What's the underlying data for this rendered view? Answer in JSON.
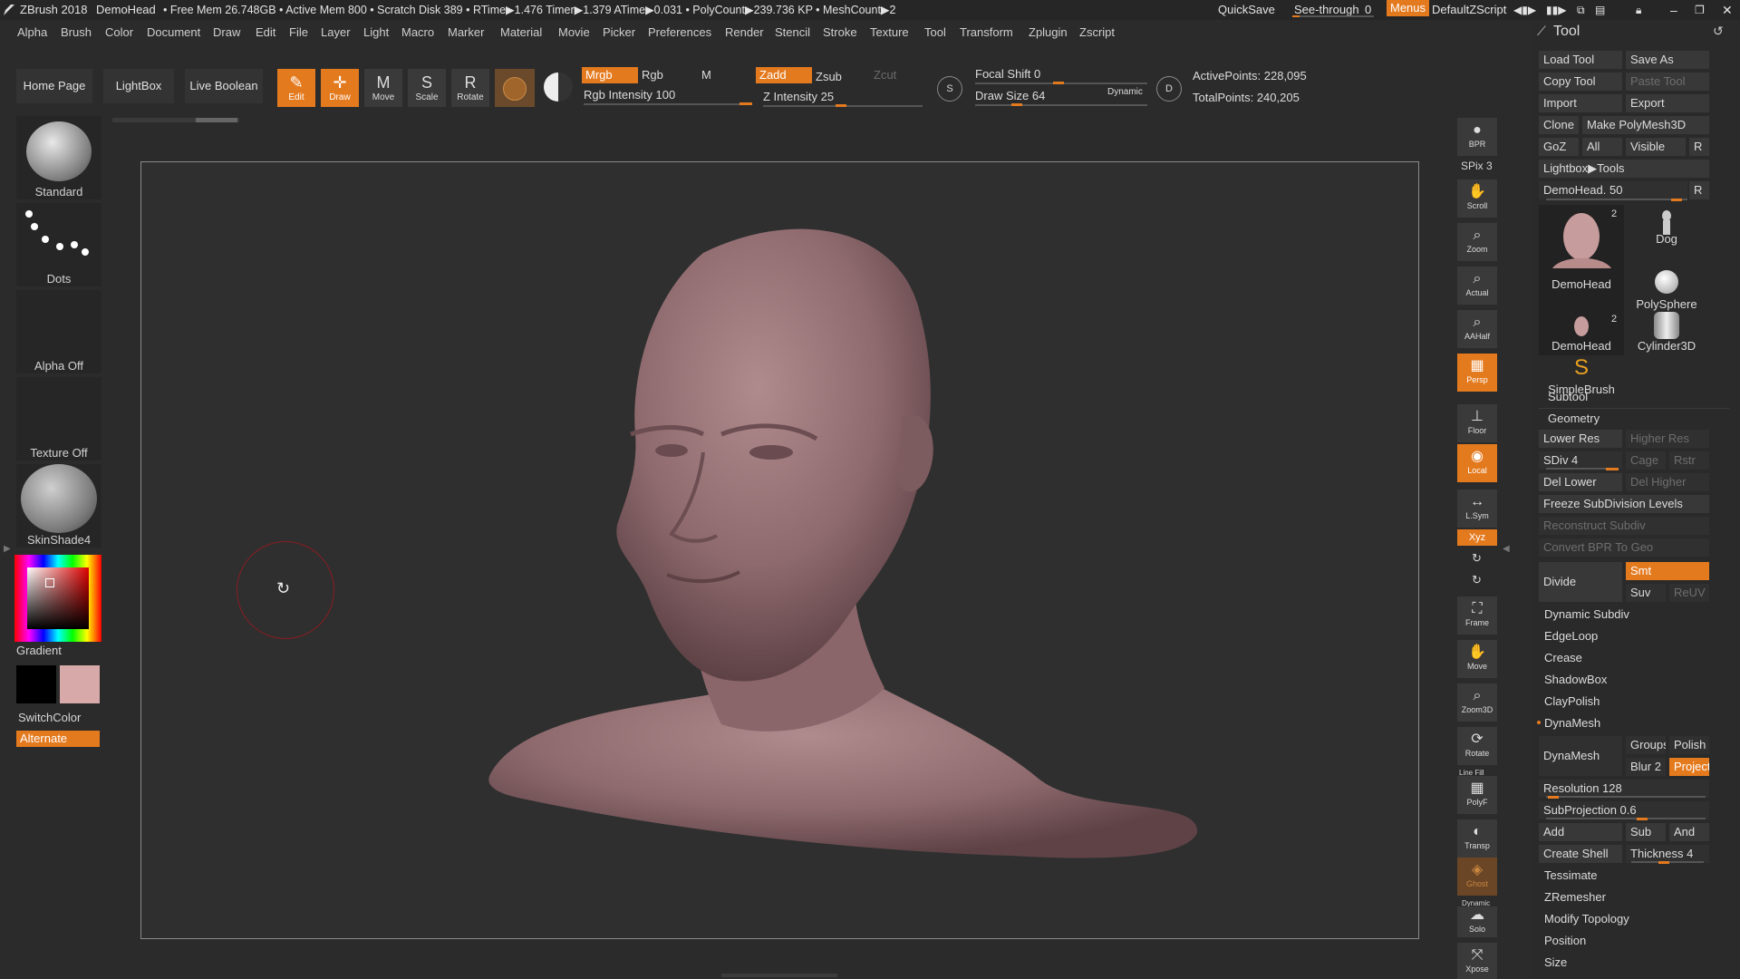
{
  "titlebar": {
    "app": "ZBrush 2018",
    "doc": "DemoHead",
    "stats": "• Free Mem 26.748GB • Active Mem 800 • Scratch Disk 389 •  RTime▶1.476 Timer▶1.379 ATime▶0.031 • PolyCount▶239.736 KP • MeshCount▶2",
    "quicksave": "QuickSave",
    "seethrough_label": "See-through",
    "seethrough_value": "0",
    "menus": "Menus",
    "script": "DefaultZScript"
  },
  "menubar": [
    "Alpha",
    "Brush",
    "Color",
    "Document",
    "Draw",
    "Edit",
    "File",
    "Layer",
    "Light",
    "Macro",
    "Marker",
    "Material",
    "Movie",
    "Picker",
    "Preferences",
    "Render",
    "Stencil",
    "Stroke",
    "Texture",
    "Tool",
    "Transform",
    "Zplugin",
    "Zscript"
  ],
  "shelf": {
    "home": "Home Page",
    "lightbox": "LightBox",
    "liveboolean": "Live Boolean",
    "edit": "Edit",
    "draw": "Draw",
    "move": "Move",
    "scale": "Scale",
    "rotate": "Rotate"
  },
  "modes": {
    "mrgb": "Mrgb",
    "rgb": "Rgb",
    "m": "M",
    "zadd": "Zadd",
    "zsub": "Zsub",
    "zcut": "Zcut",
    "rgb_intensity_label": "Rgb Intensity",
    "rgb_intensity": "100",
    "z_intensity_label": "Z Intensity",
    "z_intensity": "25",
    "focal_shift_label": "Focal Shift",
    "focal_shift": "0",
    "draw_size_label": "Draw Size",
    "draw_size": "64",
    "dynamic": "Dynamic",
    "active_points": "ActivePoints: 228,095",
    "total_points": "TotalPoints: 240,205"
  },
  "leftshelf": {
    "brush": "Standard",
    "stroke": "Dots",
    "alpha": "Alpha Off",
    "texture": "Texture Off",
    "material": "SkinShade4",
    "gradient": "Gradient",
    "switchcolor": "SwitchColor",
    "alternate": "Alternate"
  },
  "rightstrip": {
    "bpr": "BPR",
    "spix": "SPix 3",
    "scroll": "Scroll",
    "zoom": "Zoom",
    "actual": "Actual",
    "aahalf": "AAHalf",
    "persp": "Persp",
    "floor": "Floor",
    "local": "Local",
    "lsym": "L.Sym",
    "xyz": "Xyz",
    "frame": "Frame",
    "move": "Move",
    "zoom3d": "Zoom3D",
    "rotate": "Rotate",
    "polyf": "PolyF",
    "linefill": "Line Fill",
    "transp": "Transp",
    "ghost": "Ghost",
    "solo": "Solo",
    "dynamic": "Dynamic",
    "xpose": "Xpose"
  },
  "toolpanel": {
    "title": "Tool",
    "load_tool": "Load Tool",
    "save_as": "Save As",
    "copy_tool": "Copy Tool",
    "paste_tool": "Paste Tool",
    "import": "Import",
    "export": "Export",
    "clone": "Clone",
    "make_polymesh": "Make PolyMesh3D",
    "goz": "GoZ",
    "all": "All",
    "visible": "Visible",
    "r": "R",
    "lightbox_tools": "Lightbox▶Tools",
    "current_tool": "DemoHead. 50",
    "thumbs": [
      {
        "label": "DemoHead",
        "count": "2"
      },
      {
        "label": "Dog",
        "count": ""
      },
      {
        "label": "PolySphere",
        "count": ""
      },
      {
        "label": "DemoHead",
        "count": "2"
      },
      {
        "label": "Cylinder3D",
        "count": ""
      },
      {
        "label": "SimpleBrush",
        "count": ""
      }
    ],
    "subtool": "Subtool",
    "geometry": "Geometry",
    "lower_res": "Lower Res",
    "higher_res": "Higher Res",
    "sdiv": "SDiv 4",
    "cage": "Cage",
    "rstr": "Rstr",
    "del_lower": "Del Lower",
    "del_higher": "Del Higher",
    "freeze": "Freeze SubDivision Levels",
    "reconstruct": "Reconstruct Subdiv",
    "convert_bpr": "Convert BPR To Geo",
    "divide": "Divide",
    "smt": "Smt",
    "suv": "Suv",
    "reuv": "ReUV",
    "dynamic_subdiv": "Dynamic Subdiv",
    "edgeloop": "EdgeLoop",
    "crease": "Crease",
    "shadowbox": "ShadowBox",
    "claypolish": "ClayPolish",
    "dynamesh_section": "DynaMesh",
    "dynamesh_btn": "DynaMesh",
    "groups": "Groups",
    "polish": "Polish",
    "blur": "Blur 2",
    "project": "Project",
    "resolution": "Resolution 128",
    "subprojection": "SubProjection 0.6",
    "add": "Add",
    "sub": "Sub",
    "and": "And",
    "create_shell": "Create Shell",
    "thickness": "Thickness 4",
    "tessimate": "Tessimate",
    "zremesher": "ZRemesher",
    "modify_topology": "Modify Topology",
    "position": "Position",
    "size": "Size"
  },
  "colors": {
    "accent": "#e47a1e",
    "skin": "#8e6a6e",
    "secondary_color": "#d7a9a9",
    "primary_color": "#000000"
  }
}
